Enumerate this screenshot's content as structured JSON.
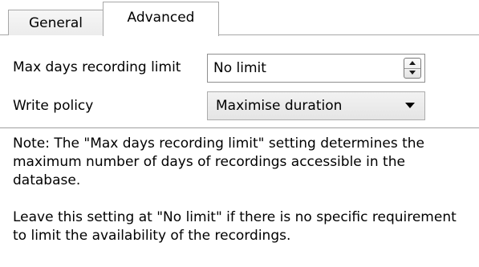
{
  "tabs": [
    {
      "label": "General",
      "selected": false
    },
    {
      "label": "Advanced",
      "selected": true
    }
  ],
  "form": {
    "max_days": {
      "label": "Max days recording limit",
      "value": "No limit"
    },
    "write_policy": {
      "label": "Write policy",
      "value": "Maximise duration"
    }
  },
  "note": {
    "paragraph1": "Note: The \"Max days recording limit\" setting determines the maximum number of days of recordings accessible in the database.",
    "paragraph2": "Leave this setting at \"No limit\" if there is no specific requirement to limit the availability of the recordings."
  },
  "icons": {
    "spinner": "spin-up-down-icon",
    "dropdown": "chevron-down-icon"
  }
}
